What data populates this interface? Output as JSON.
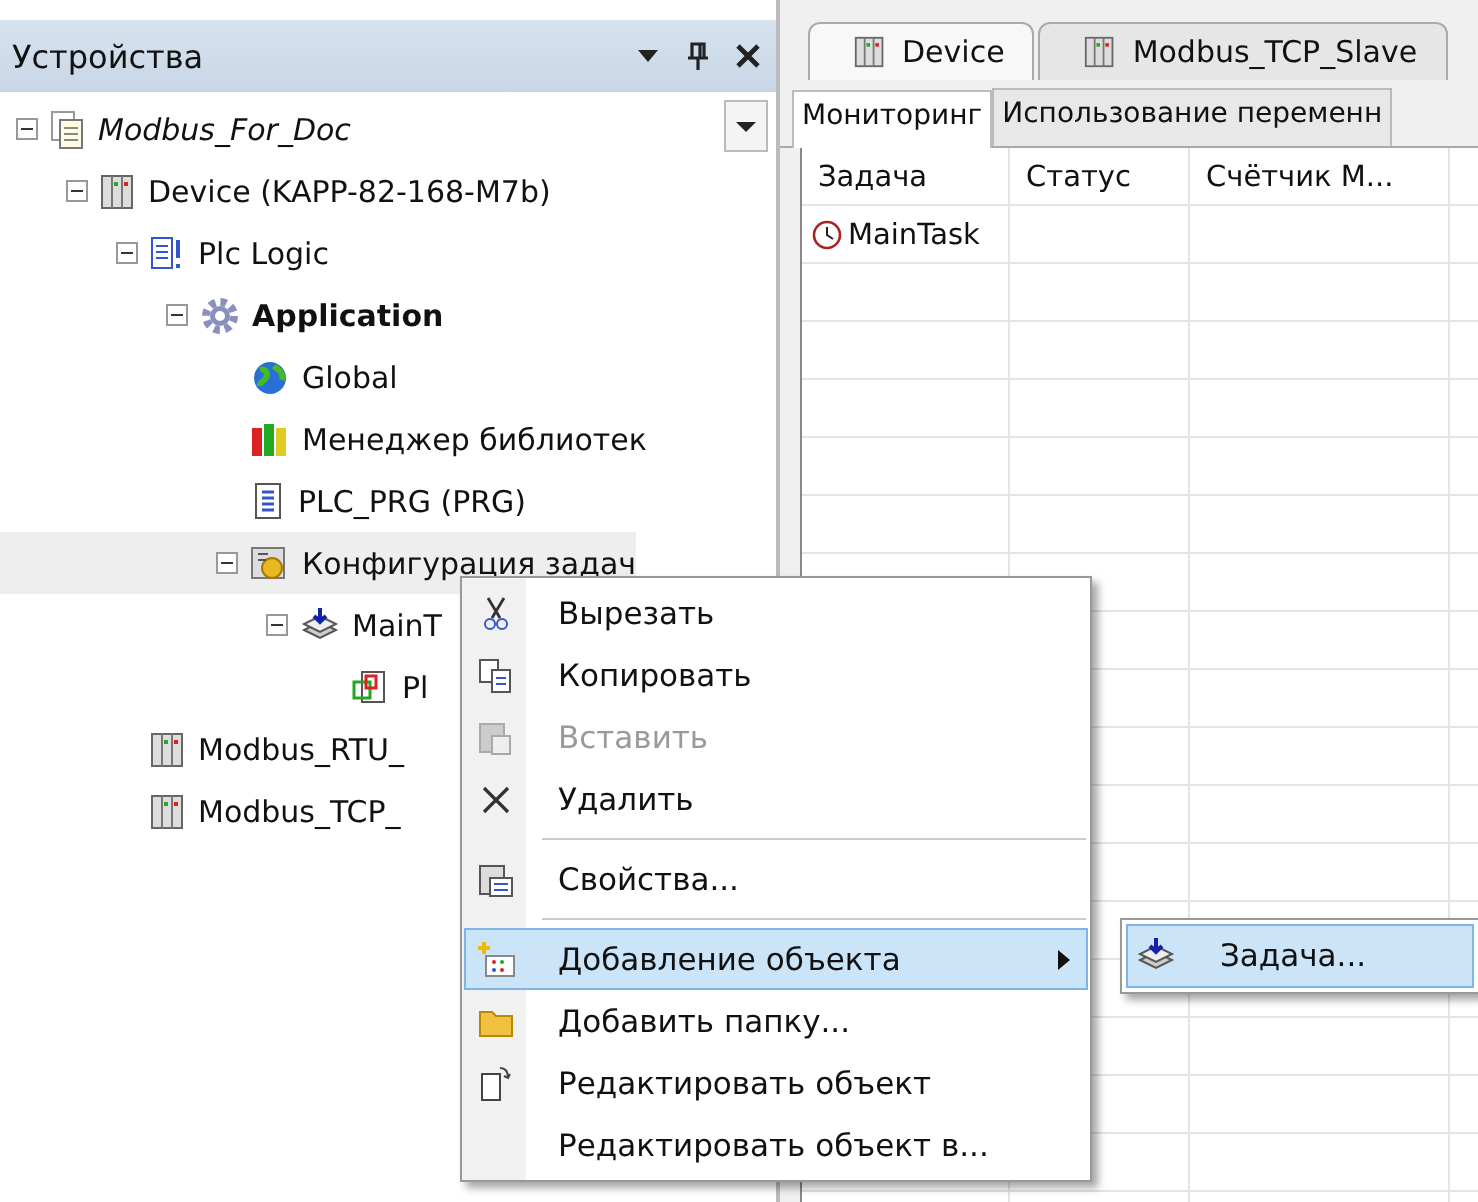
{
  "devices_panel": {
    "title": "Устройства",
    "tree": [
      {
        "label": "Modbus_For_Doc",
        "kind": "project",
        "expanded": true,
        "children": [
          {
            "label": "Device (KAPP-82-168-M7b)",
            "kind": "device",
            "expanded": true,
            "children": [
              {
                "label": "Plc Logic",
                "kind": "logic",
                "expanded": true,
                "children": [
                  {
                    "label": "Application",
                    "kind": "application",
                    "expanded": true,
                    "children": [
                      {
                        "label": "Global",
                        "kind": "globals"
                      },
                      {
                        "label": "Менеджер библиотек",
                        "kind": "libraries"
                      },
                      {
                        "label": "PLC_PRG (PRG)",
                        "kind": "program"
                      },
                      {
                        "label": "Конфигурация задач",
                        "kind": "taskconfig",
                        "hovered": true,
                        "expanded": true,
                        "children": [
                          {
                            "label": "MainT",
                            "kind": "task",
                            "expanded": true,
                            "children": [
                              {
                                "label": "Pl",
                                "kind": "call"
                              }
                            ]
                          }
                        ]
                      }
                    ]
                  }
                ]
              },
              {
                "label": "Modbus_RTU_",
                "kind": "device"
              },
              {
                "label": "Modbus_TCP_",
                "kind": "device"
              }
            ]
          }
        ]
      }
    ]
  },
  "editor": {
    "tabs": [
      {
        "label": "Device",
        "selected": true
      },
      {
        "label": "Modbus_TCP_Slave",
        "selected": false
      }
    ],
    "subtabs": [
      {
        "label": "Мониторинг",
        "selected": true
      },
      {
        "label": "Использование переменн",
        "selected": false
      }
    ],
    "table": {
      "columns": [
        "Задача",
        "Статус",
        "Счётчик М..."
      ],
      "rows": [
        [
          "MainTask",
          "",
          ""
        ]
      ]
    }
  },
  "context_menu": {
    "items": [
      {
        "label": "Вырезать",
        "kind": "cut",
        "disabled": false,
        "selected": false
      },
      {
        "label": "Копировать",
        "kind": "copy",
        "disabled": false,
        "selected": false
      },
      {
        "label": "Вставить",
        "kind": "paste",
        "disabled": true,
        "selected": false
      },
      {
        "label": "Удалить",
        "kind": "delete",
        "disabled": false,
        "selected": false
      },
      {
        "label": "Свойства...",
        "kind": "properties",
        "separator_before": true,
        "disabled": false,
        "selected": false
      },
      {
        "label": "Добавление объекта",
        "kind": "add",
        "separator_before": true,
        "submenu": true,
        "disabled": false,
        "selected": true
      },
      {
        "label": "Добавить папку...",
        "kind": "folder",
        "disabled": false,
        "selected": false
      },
      {
        "label": "Редактировать объект",
        "kind": "edit",
        "disabled": false,
        "selected": false
      },
      {
        "label": "Редактировать объект в...",
        "kind": "plain",
        "disabled": false,
        "selected": false
      }
    ],
    "submenu": [
      {
        "label": "Задача...",
        "kind": "task",
        "selected": true
      }
    ]
  }
}
